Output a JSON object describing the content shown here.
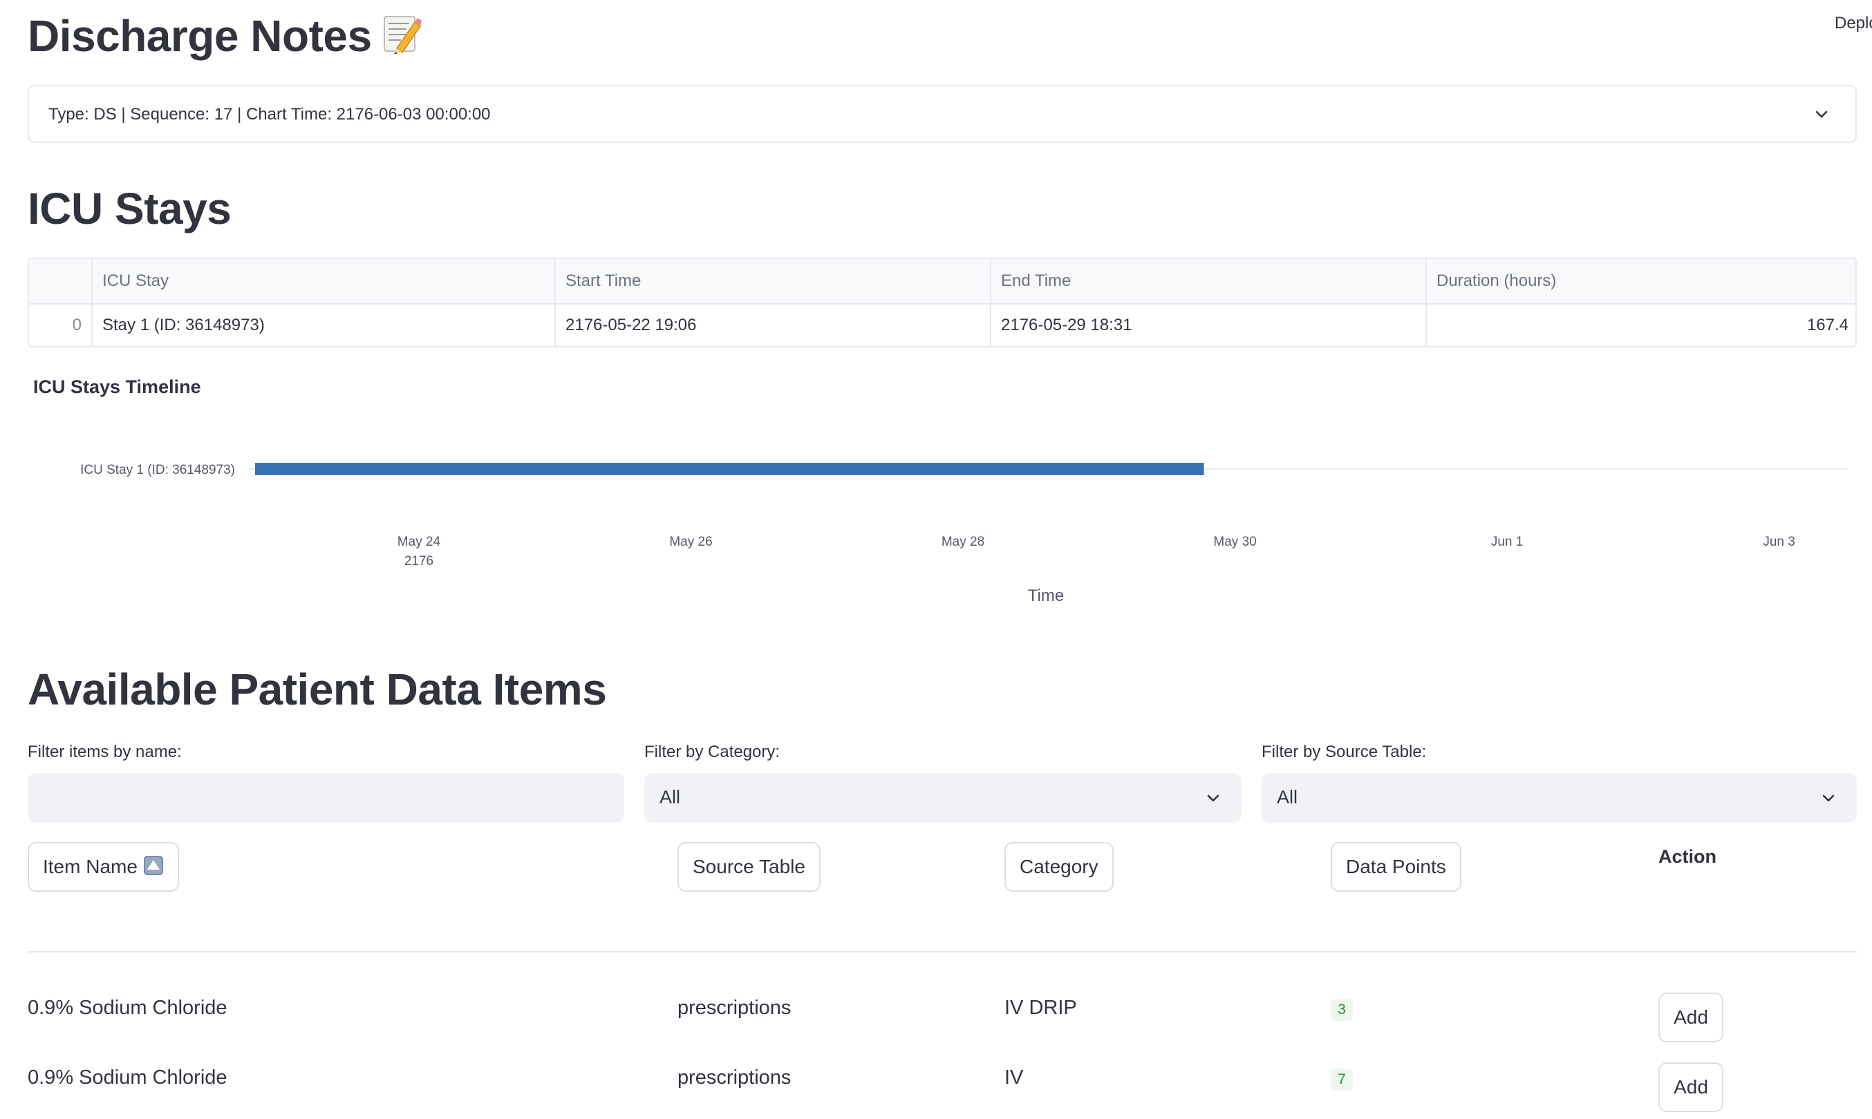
{
  "header": {
    "deploy_label": "Deplo"
  },
  "discharge": {
    "title": "Discharge Notes",
    "title_icon": "memo-icon",
    "expander_label": "Type: DS | Sequence: 17 | Chart Time: 2176-06-03 00:00:00"
  },
  "icu": {
    "title": "ICU Stays",
    "table": {
      "columns": [
        "",
        "ICU Stay",
        "Start Time",
        "End Time",
        "Duration (hours)"
      ],
      "rows": [
        {
          "index": "0",
          "stay": "Stay 1 (ID: 36148973)",
          "start": "2176-05-22 19:06",
          "end": "2176-05-29 18:31",
          "duration": "167.4"
        }
      ]
    },
    "timeline_title": "ICU Stays Timeline",
    "chart_data": {
      "type": "bar",
      "orientation": "horizontal-timeline",
      "categories": [
        "ICU Stay 1 (ID: 36148973)"
      ],
      "series": [
        {
          "start": "2176-05-22 19:06",
          "end": "2176-05-29 18:31",
          "color": "#3872b3"
        }
      ],
      "x_ticks": [
        {
          "label": "May 24",
          "sub": "2176",
          "date": "2176-05-24"
        },
        {
          "label": "May 26",
          "sub": "",
          "date": "2176-05-26"
        },
        {
          "label": "May 28",
          "sub": "",
          "date": "2176-05-28"
        },
        {
          "label": "May 30",
          "sub": "",
          "date": "2176-05-30"
        },
        {
          "label": "Jun 1",
          "sub": "",
          "date": "2176-06-01"
        },
        {
          "label": "Jun 3",
          "sub": "",
          "date": "2176-06-03"
        }
      ],
      "xlabel": "Time",
      "ylabel": "",
      "xlim": [
        "2176-05-22 18:00",
        "2176-06-03 12:00"
      ],
      "grid": false
    }
  },
  "items_section": {
    "title": "Available Patient Data Items",
    "filter_name_label": "Filter items by name:",
    "filter_name_value": "",
    "filter_category_label": "Filter by Category:",
    "filter_category_value": "All",
    "filter_source_label": "Filter by Source Table:",
    "filter_source_value": "All",
    "headers": {
      "item_name": "Item Name",
      "source_table": "Source Table",
      "category": "Category",
      "data_points": "Data Points",
      "action": "Action"
    },
    "sort_icon": "sort-ascending-icon",
    "rows": [
      {
        "name": "0.9% Sodium Chloride",
        "source": "prescriptions",
        "category": "IV DRIP",
        "points": "3",
        "action": "Add"
      },
      {
        "name": "0.9% Sodium Chloride",
        "source": "prescriptions",
        "category": "IV",
        "points": "7",
        "action": "Add"
      }
    ]
  },
  "colors": {
    "accent_bar": "#3872b3",
    "badge_bg": "#edf7ee",
    "badge_text": "#2c8a3e",
    "text": "#31333f",
    "input_bg": "#f0f2f6"
  }
}
